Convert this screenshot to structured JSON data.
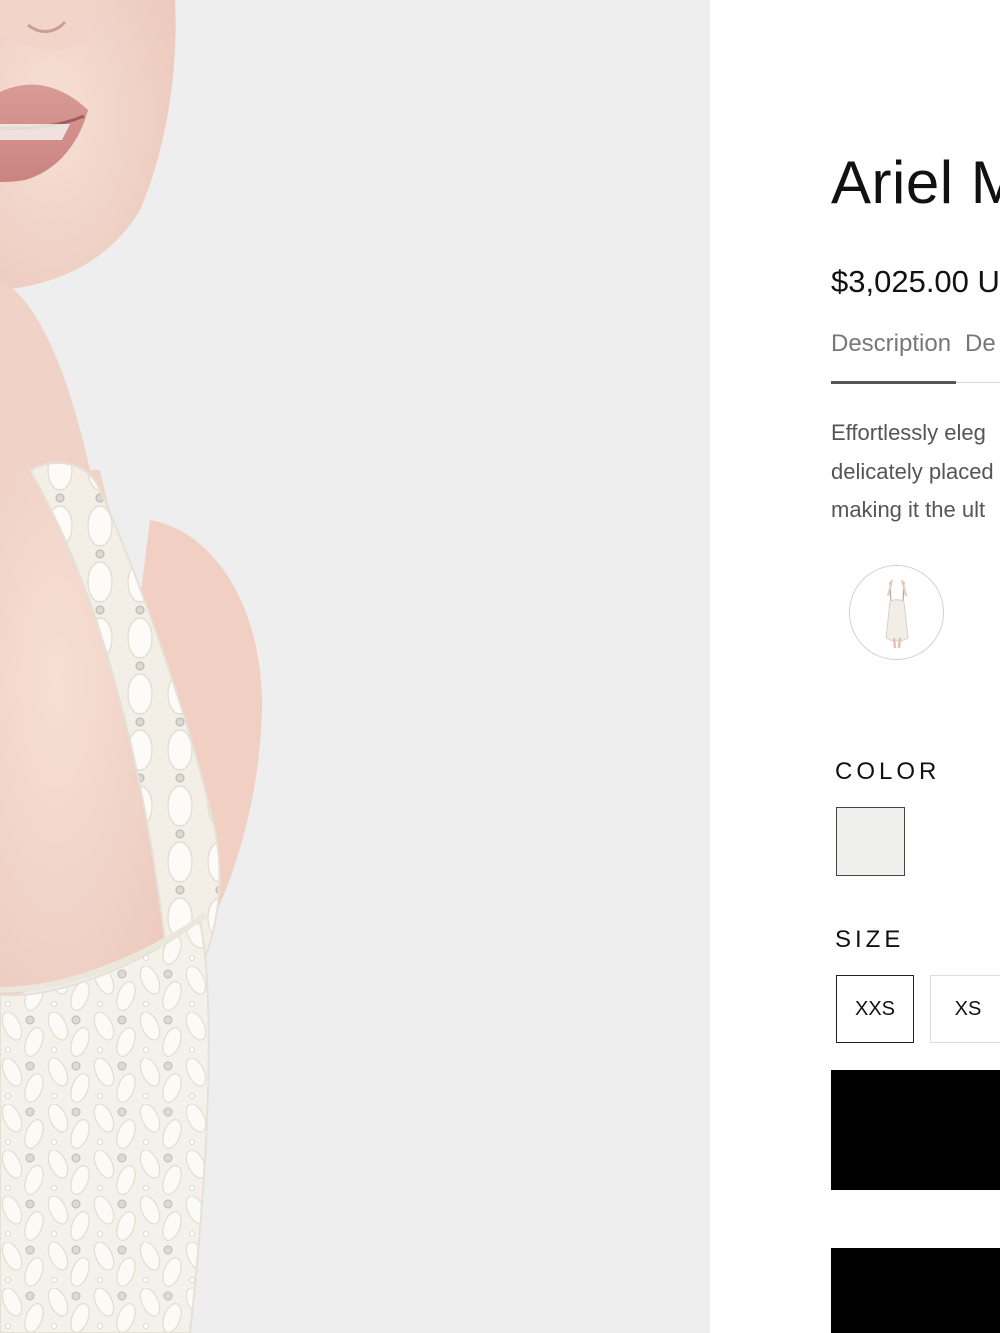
{
  "product": {
    "title": "Ariel M",
    "price": "$3,025.00 U",
    "tabs": [
      {
        "label": "Description",
        "active": true
      },
      {
        "label": "De",
        "active": false
      }
    ],
    "description_lines": [
      "Effortlessly eleg",
      "delicately placed",
      "making it the ult"
    ],
    "thumbnail_icon": "dress-thumbnail",
    "color": {
      "label": "COLOR",
      "swatches": [
        {
          "color": "#efefed",
          "selected": true
        }
      ]
    },
    "size": {
      "label": "SIZE",
      "options": [
        {
          "label": "XXS",
          "selected": true
        },
        {
          "label": "XS",
          "selected": false
        }
      ]
    },
    "buttons": [
      {
        "label": ""
      },
      {
        "label": ""
      }
    ]
  },
  "colors": {
    "photo_background": "#eeeeee",
    "accent_black": "#000000",
    "muted_text": "#555555"
  }
}
